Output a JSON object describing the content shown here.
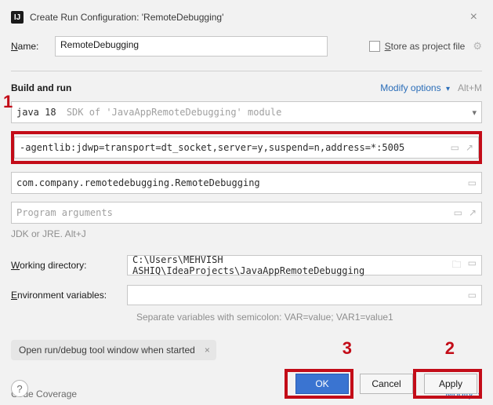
{
  "title": "Create Run Configuration: 'RemoteDebugging'",
  "name": {
    "label": "Name:",
    "value": "RemoteDebugging"
  },
  "store_as_project_file": "Store as project file",
  "build_and_run": {
    "title": "Build and run",
    "modify_options": "Modify options",
    "modify_shortcut": "Alt+M",
    "jre_value": "java 18",
    "jre_hint": "SDK of 'JavaAppRemoteDebugging' module",
    "vm_options_value": "-agentlib:jdwp=transport=dt_socket,server=y,suspend=n,address=*:5005",
    "main_class_value": "com.company.remotedebugging.RemoteDebugging",
    "program_args_placeholder": "Program arguments",
    "help_text": "JDK or JRE. Alt+J"
  },
  "working_dir": {
    "label": "Working directory:",
    "value": "C:\\Users\\MEHVISH ASHIQ\\IdeaProjects\\JavaAppRemoteDebugging"
  },
  "env_vars": {
    "label": "Environment variables:",
    "value": "",
    "hint": "Separate variables with semicolon: VAR=value; VAR1=value1"
  },
  "pill": {
    "label": "Open run/debug tool window when started",
    "close": "×"
  },
  "code_coverage": {
    "label": "Code Coverage",
    "modify": "Modify"
  },
  "footer": {
    "ok": "OK",
    "cancel": "Cancel",
    "apply": "Apply"
  },
  "callouts": {
    "one": "1",
    "two": "2",
    "three": "3"
  }
}
